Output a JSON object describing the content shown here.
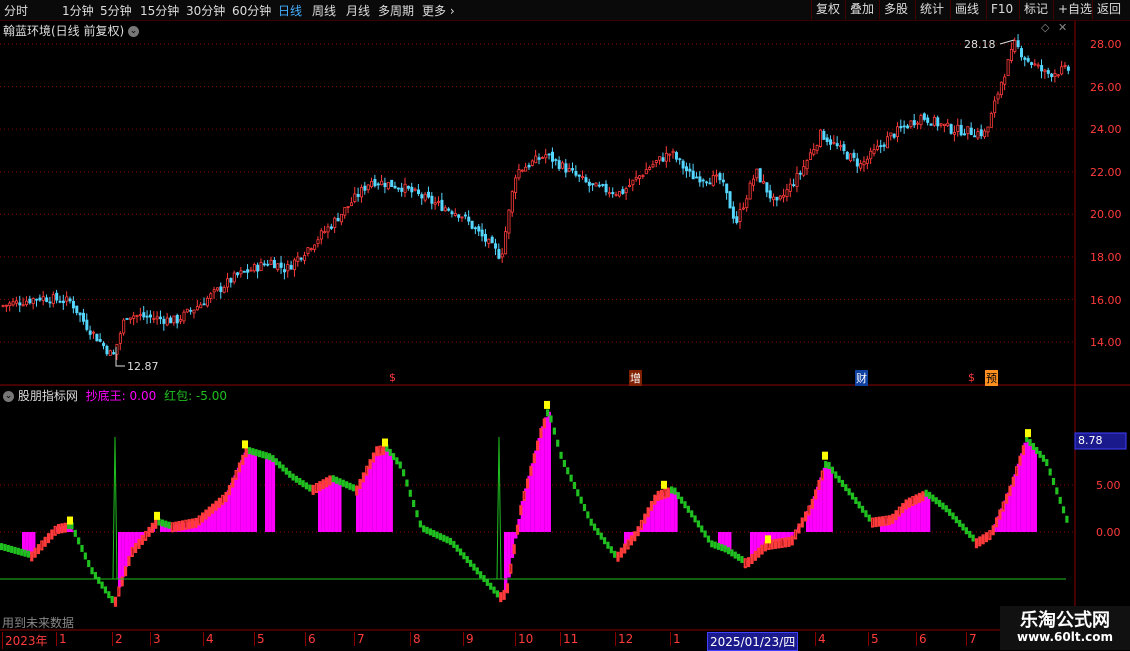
{
  "toolbar": {
    "periods": [
      "分时",
      "1分钟",
      "5分钟",
      "15分钟",
      "30分钟",
      "60分钟",
      "日线",
      "周线",
      "月线",
      "多周期",
      "更多"
    ],
    "active_period": "日线",
    "more_arrow": "›",
    "right_buttons": [
      "复权",
      "叠加",
      "多股",
      "统计",
      "画线",
      "F10",
      "标记",
      "+自选",
      "返回"
    ]
  },
  "main_chart": {
    "title": "翰蓝环境(日线 前复权)",
    "price_ticks": [
      "28.00",
      "26.00",
      "24.00",
      "22.00",
      "20.00",
      "18.00",
      "16.00",
      "14.00"
    ],
    "high_label": "28.18",
    "low_label": "12.87",
    "event_markers": [
      "$",
      "增",
      "财",
      "$",
      "预"
    ]
  },
  "indicator": {
    "name": "股朋指标网",
    "series1_label": "抄底王: 0.00",
    "series2_label": "红包: -5.00",
    "ticks": [
      "5.00",
      "0.00"
    ],
    "current_value": "8.78",
    "footer_note": "用到未来数据"
  },
  "time_axis": {
    "labels": [
      "2023年",
      "1",
      "2",
      "3",
      "4",
      "5",
      "6",
      "7",
      "8",
      "9",
      "10",
      "11",
      "12",
      "1",
      "2025/01/23/四",
      "4",
      "5",
      "6",
      "7"
    ]
  },
  "watermark": {
    "title": "乐淘公式网",
    "url": "www.60lt.com"
  },
  "colors": {
    "up": "#ff3b3b",
    "down": "#54d6ff",
    "magenta": "#ff00ff",
    "green": "#20c020",
    "yellow": "#ffff00",
    "grid": "#8a0000"
  }
}
